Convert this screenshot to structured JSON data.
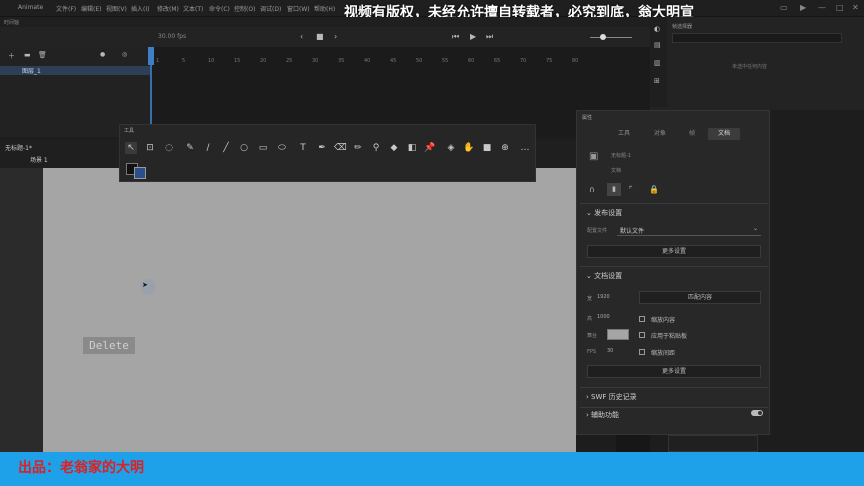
{
  "watermark": "视频有版权，未经允许擅自转载者，必究到底，翁大明宣",
  "footer_credit": "出品：老翁家的大明",
  "menubar": {
    "app_name": "Animate",
    "items": [
      "文件(F)",
      "编辑(E)",
      "视图(V)",
      "插入(I)",
      "修改(M)",
      "文本(T)",
      "命令(C)",
      "控制(O)",
      "调试(D)",
      "窗口(W)",
      "帮助(H)"
    ]
  },
  "timeline": {
    "header": "时间轴",
    "fps_readout": "30.00 fps",
    "layer_name": "图层_1",
    "frame_numbers": [
      "1",
      "5",
      "10",
      "15",
      "20",
      "25",
      "30",
      "35",
      "40",
      "45",
      "50",
      "55",
      "60",
      "65",
      "70",
      "75",
      "80"
    ]
  },
  "document": {
    "tab": "无标题-1*",
    "scene": "场景 1"
  },
  "stage": {
    "delete_label": "Delete"
  },
  "toolbox": {
    "title": "工具"
  },
  "properties": {
    "title": "属性",
    "tabs": [
      "工具",
      "对象",
      "帧",
      "文档"
    ],
    "active_tab": "文档",
    "doc_name": "无标题-1",
    "doc_type": "文档",
    "publish_section": "发布设置",
    "profile_label": "配置文件",
    "profile_value": "默认文件",
    "more_settings": "更多设置",
    "doc_section": "文档设置",
    "width_label": "宽",
    "width_value": "1920",
    "height_label": "高",
    "height_value": "1000",
    "match_button": "匹配内容",
    "scale_content": "缩放内容",
    "apply_pasteboard": "应用于粘贴板",
    "scale_spacing": "缩放间距",
    "stage_label": "舞台",
    "fps_label": "FPS",
    "fps_value": "30",
    "more_settings2": "更多设置",
    "swf_history": "SWF 历史记录",
    "accessibility": "辅助功能"
  },
  "right_panel": {
    "title": "帧选择器",
    "empty_text": "未选中任何内容"
  }
}
